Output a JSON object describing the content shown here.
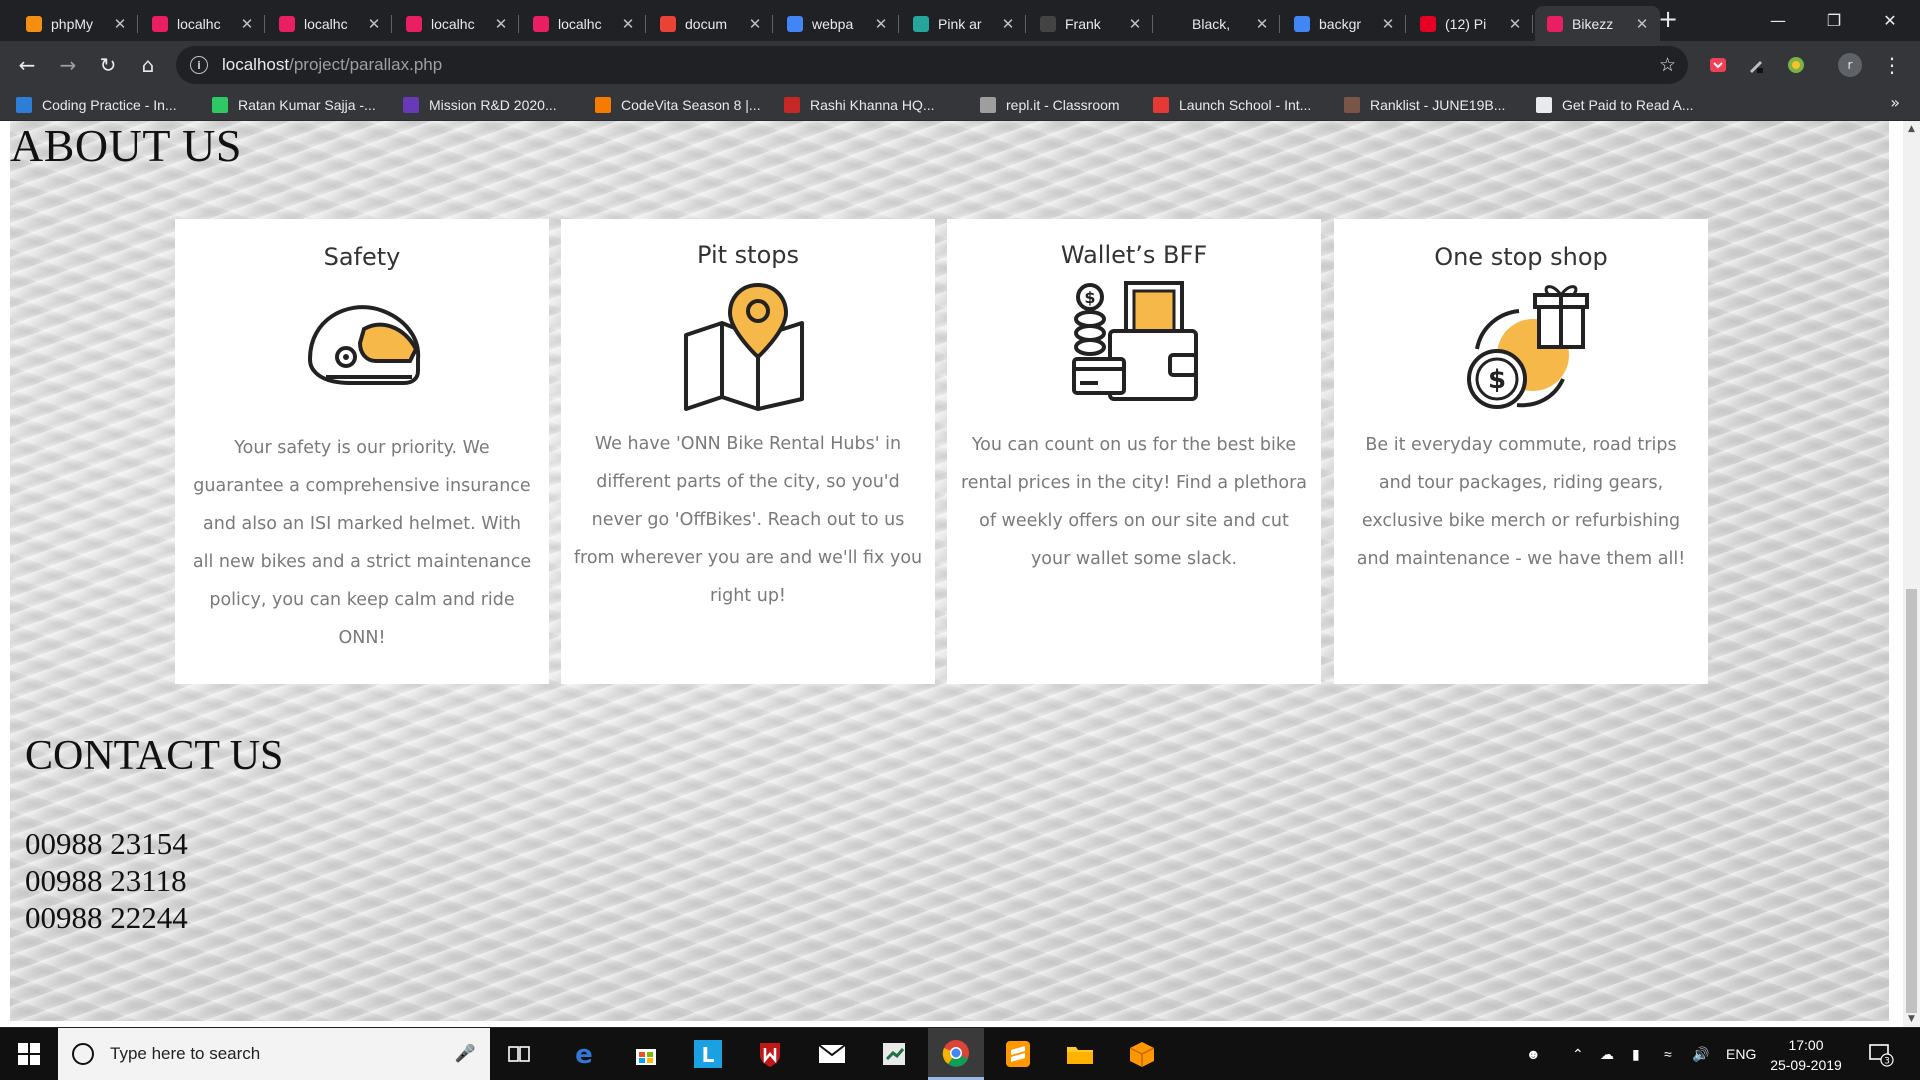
{
  "browser": {
    "tabs": [
      {
        "title": "phpMy",
        "favicon": "phpmyadmin-icon",
        "color": "#f29111",
        "active": false
      },
      {
        "title": "localhc",
        "favicon": "localhost-icon",
        "color": "#e91e63",
        "active": false
      },
      {
        "title": "localhc",
        "favicon": "localhost-icon",
        "color": "#e91e63",
        "active": false
      },
      {
        "title": "localhc",
        "favicon": "localhost-icon",
        "color": "#e91e63",
        "active": false
      },
      {
        "title": "localhc",
        "favicon": "localhost-icon",
        "color": "#e91e63",
        "active": false
      },
      {
        "title": "docum",
        "favicon": "gmail-icon",
        "color": "#ea4335",
        "active": false
      },
      {
        "title": "webpa",
        "favicon": "google-icon",
        "color": "#4285f4",
        "active": false
      },
      {
        "title": "Pink ar",
        "favicon": "doc-icon",
        "color": "#26a69a",
        "active": false
      },
      {
        "title": "Frank",
        "favicon": "frank-icon",
        "color": "#444444",
        "active": false
      },
      {
        "title": "Black,",
        "favicon": "blank-icon",
        "color": "#202124",
        "active": false
      },
      {
        "title": "backgr",
        "favicon": "google-icon",
        "color": "#4285f4",
        "active": false
      },
      {
        "title": "(12) Pi",
        "favicon": "pinterest-icon",
        "color": "#e60023",
        "active": false
      },
      {
        "title": "Bikezz",
        "favicon": "localhost-icon",
        "color": "#e91e63",
        "active": true
      }
    ],
    "url_host": "localhost",
    "url_path": "/project/parallax.php",
    "bookmarks": [
      {
        "label": "Coding Practice - In...",
        "icon": "interviewbit-icon",
        "color": "#2e7dd7"
      },
      {
        "label": "Ratan Kumar Sajja -...",
        "icon": "hackerrank-icon",
        "color": "#2ec866"
      },
      {
        "label": "Mission R&D 2020...",
        "icon": "form-icon",
        "color": "#673ab7"
      },
      {
        "label": "CodeVita Season 8 |...",
        "icon": "codevita-icon",
        "color": "#f57c00"
      },
      {
        "label": "Rashi Khanna HQ...",
        "icon": "flag-icon",
        "color": "#c62828"
      },
      {
        "label": "repl.it - Classroom",
        "icon": "replit-icon",
        "color": "#9e9e9e"
      },
      {
        "label": "Launch School - Int...",
        "icon": "launchschool-icon",
        "color": "#e53935"
      },
      {
        "label": "Ranklist - JUNE19B...",
        "icon": "codechef-icon",
        "color": "#795548"
      },
      {
        "label": "Get Paid to Read A...",
        "icon": "globe-icon",
        "color": "#e8eaed"
      }
    ]
  },
  "page": {
    "about_title": "ABOUT US",
    "cards": [
      {
        "title": "Safety",
        "icon": "helmet-icon",
        "text_lines": [
          "Your safety is our priority. We",
          "guarantee a comprehensive insurance",
          "and also an ISI marked helmet. With",
          "all new bikes and a strict maintenance",
          "policy, you can keep calm and ride",
          "ONN!"
        ]
      },
      {
        "title": "Pit stops",
        "icon": "map-pin-icon",
        "text_lines": [
          "We have 'ONN Bike Rental Hubs' in",
          "different parts of the city, so you'd",
          "never go 'OffBikes'. Reach out to us",
          "from wherever you are and we'll fix you",
          "right up!"
        ]
      },
      {
        "title": "Wallet’s BFF",
        "icon": "wallet-icon",
        "text_lines": [
          "You can count on us for the best bike",
          "rental prices in the city! Find a plethora",
          "of weekly offers on our site and cut",
          "your wallet some slack."
        ]
      },
      {
        "title": "One stop shop",
        "icon": "gift-coin-icon",
        "text_lines": [
          "Be it everyday commute, road trips",
          "and tour packages, riding gears,",
          "exclusive bike merch or refurbishing",
          "and maintenance - we have them all!"
        ]
      }
    ],
    "contact_title": "CONTACT US",
    "phones": [
      "00988 23154",
      "00988 23118",
      "00988 22244"
    ],
    "accent_color": "#f7b84a"
  },
  "taskbar": {
    "search_placeholder": "Type here to search",
    "apps": [
      "task-view-icon",
      "edge-icon",
      "store-icon",
      "l-app-icon",
      "mcafee-icon",
      "mail-icon",
      "excel-like-icon",
      "chrome-icon",
      "sublime-icon",
      "file-explorer-icon",
      "package-icon"
    ],
    "language": "ENG",
    "time": "17:00",
    "date": "25-09-2019",
    "notification_count": "3"
  }
}
